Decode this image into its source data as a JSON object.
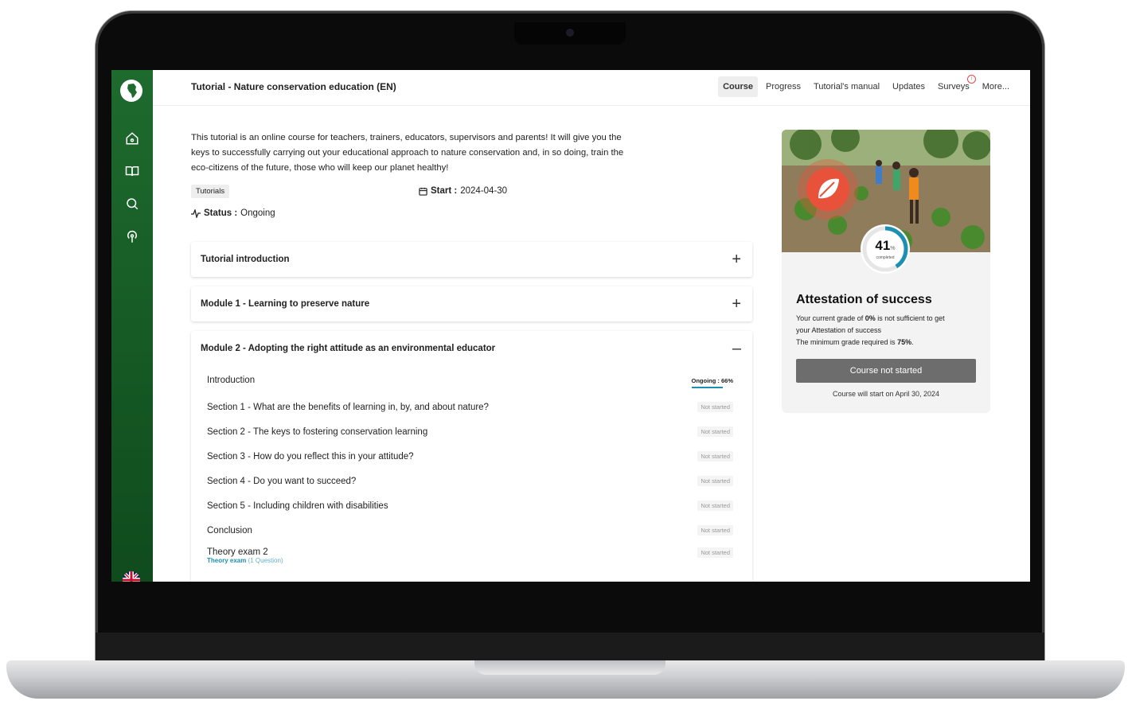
{
  "header": {
    "course_title": "Tutorial - Nature conservation education (EN)",
    "tabs": [
      "Course",
      "Progress",
      "Tutorial's manual",
      "Updates",
      "Surveys",
      "More..."
    ],
    "surveys_badge": "!"
  },
  "sidebar": {
    "icons": [
      "home-icon",
      "book-icon",
      "search-icon",
      "podcast-icon"
    ],
    "language_flag": "uk-flag-icon"
  },
  "course": {
    "description": "This tutorial is an online course for teachers, trainers, educators, supervisors and parents! It will give you the keys to successfully carrying out your educational approach to nature conservation and, in so doing, train the eco-citizens of the future, those who will keep our planet healthy!",
    "tag": "Tutorials",
    "start_label": "Start :",
    "start_date": "2024-04-30",
    "status_label": "Status :",
    "status_value": "Ongoing"
  },
  "accordion": {
    "items": [
      {
        "title": "Tutorial introduction",
        "toggle": "+"
      },
      {
        "title": "Module 1 - Learning to preserve nature",
        "toggle": "+"
      },
      {
        "title": "Module 2 - Adopting the right attitude as an environmental educator",
        "toggle": "–"
      }
    ],
    "module2_sections": [
      {
        "name": "Introduction",
        "status": "Ongoing : 66%",
        "progress": 0.66
      },
      {
        "name": "Section 1 - What are the benefits of learning in, by, and about nature?",
        "status": "Not started"
      },
      {
        "name": "Section 2 - The keys to fostering conservation learning",
        "status": "Not started"
      },
      {
        "name": "Section 3 - How do you reflect this in your attitude?",
        "status": "Not started"
      },
      {
        "name": "Section 4 - Do you want to succeed?",
        "status": "Not started"
      },
      {
        "name": "Section 5 - Including children with disabilities",
        "status": "Not started"
      },
      {
        "name": "Conclusion",
        "status": "Not started"
      },
      {
        "name": "Theory exam 2",
        "status": "Not started",
        "sub_type": "Theory exam",
        "sub_count": "(1 Question)"
      }
    ]
  },
  "card": {
    "percent": "41",
    "percent_sign": "%",
    "completed_label": "completed",
    "progress": 0.41,
    "title": "Attestation of success",
    "line1_a": "Your current grade of ",
    "line1_b": "0%",
    "line1_c": " is not sufficient to get",
    "line2": "your Attestation of success",
    "line3_a": "The minimum grade required is ",
    "line3_b": "75%",
    "line3_c": ".",
    "button": "Course not started",
    "start_note": "Course will start on April 30, 2024"
  },
  "colors": {
    "sidebar_green": "#1e6b2e",
    "accent_blue": "#1d8fb3",
    "brand_orange_red": "#e8523a"
  }
}
